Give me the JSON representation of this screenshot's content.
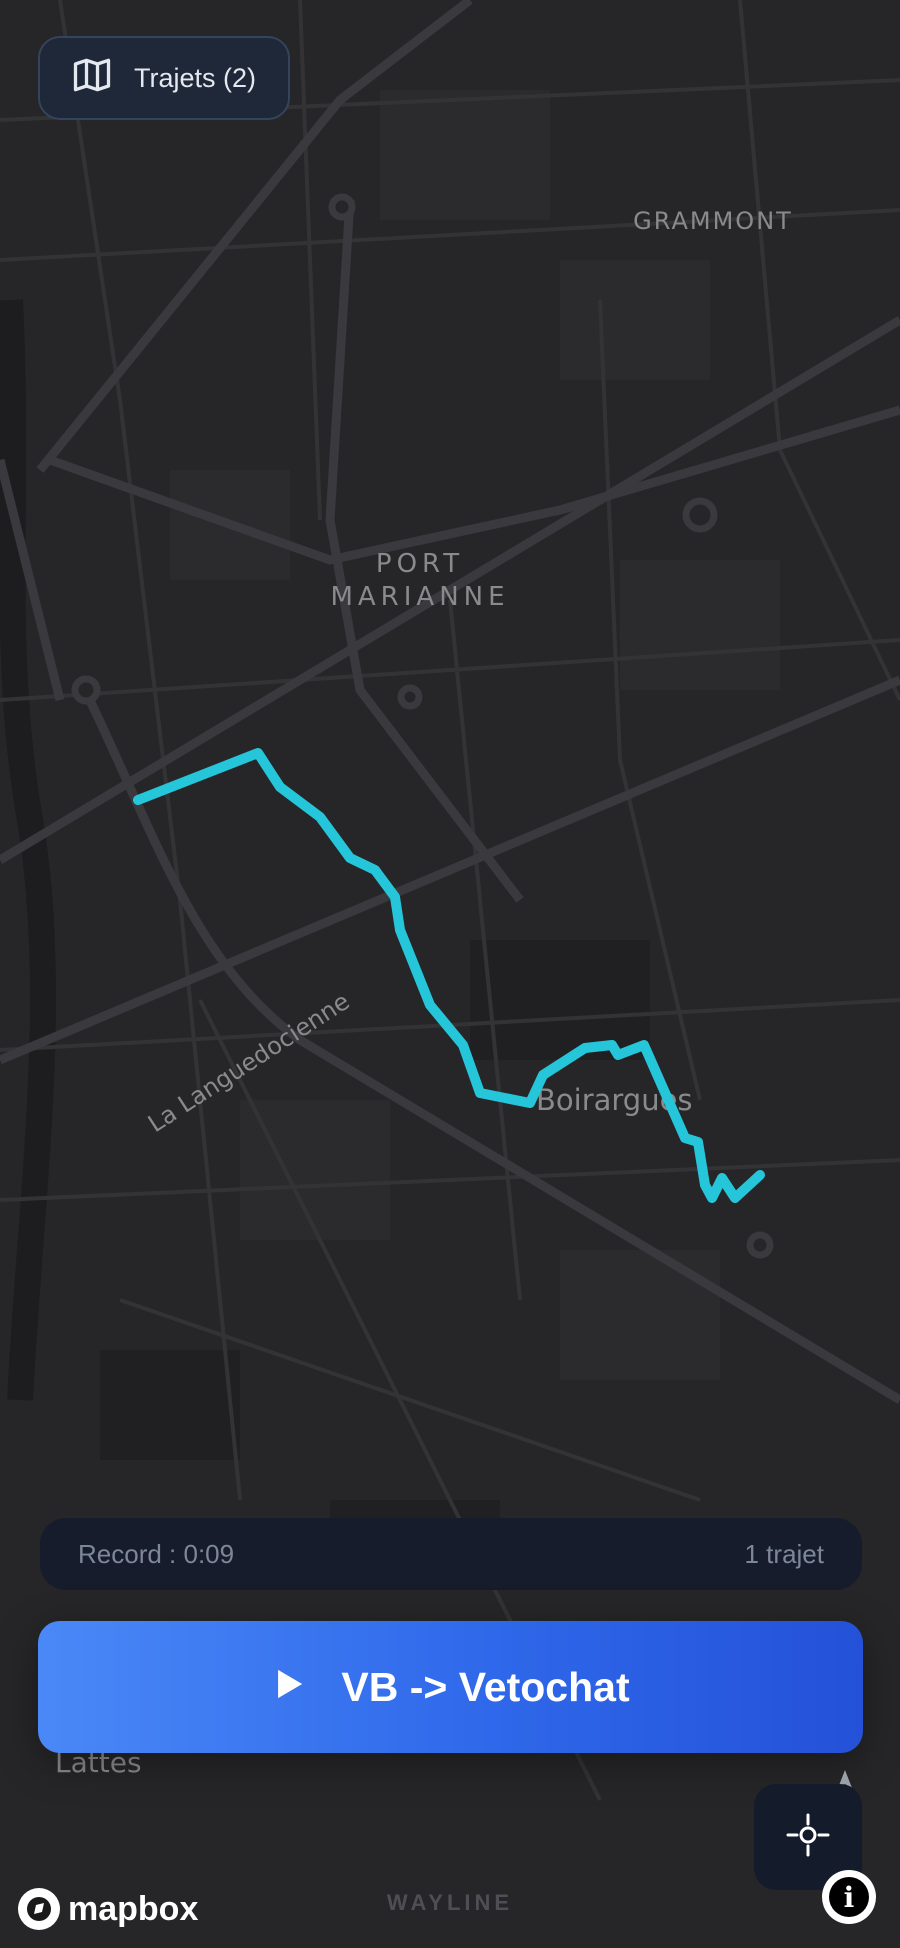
{
  "header": {
    "trips_button": {
      "label": "Trajets (2)",
      "icon": "map-icon"
    }
  },
  "map": {
    "labels": {
      "grammont": "GRAMMONT",
      "port": "PORT",
      "marianne": "MARIANNE",
      "languedocienne": "La Languedocienne",
      "boirargues": "Boirargues",
      "lattes": "Lattes"
    },
    "route_color": "#26c6da"
  },
  "record_bar": {
    "left_text": "Record : 0:09",
    "right_text": "1 trajet"
  },
  "play_button": {
    "label": "VB -> Vetochat",
    "icon": "play-icon",
    "accent": "#3a70ef"
  },
  "locate_button": {
    "icon": "locate-crosshair-icon"
  },
  "compass_button": {
    "icon": "compass-arrow-icon"
  },
  "footer": {
    "mapbox_text": "mapbox",
    "brand": "WAYLINE",
    "info_label": "i"
  }
}
